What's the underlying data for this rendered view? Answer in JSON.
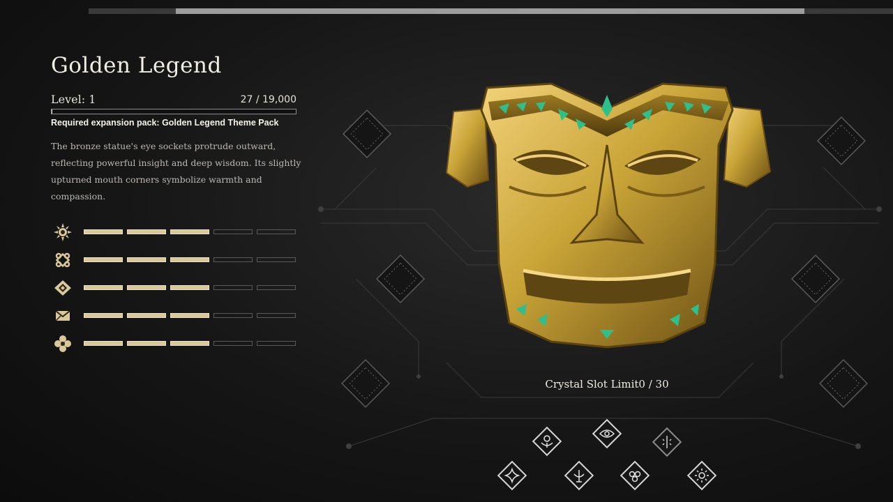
{
  "item": {
    "title": "Golden Legend",
    "level_text": "Level: 1",
    "xp_text": "27 / 19,000",
    "xp_progress": 0.0014,
    "required_pack": "Required expansion pack: Golden Legend Theme Pack",
    "description": "The bronze statue's eye sockets protrude outward, reflecting powerful insight and deep wisdom. Its slightly upturned mouth corners symbolize warmth and compassion."
  },
  "stats": [
    {
      "icon": "sun-emblem-icon",
      "filled": 3,
      "total": 5
    },
    {
      "icon": "knot-emblem-icon",
      "filled": 3,
      "total": 5
    },
    {
      "icon": "diamond-emblem-icon",
      "filled": 3,
      "total": 5
    },
    {
      "icon": "envelope-emblem-icon",
      "filled": 3,
      "total": 5
    },
    {
      "icon": "flower-emblem-icon",
      "filled": 3,
      "total": 5
    }
  ],
  "crystal_slot_label": "Crystal Slot Limit0 / 30",
  "crystals": [
    "flower-crystal-icon",
    "eye-crystal-icon",
    "rune-crystal-icon",
    "star-crystal-icon",
    "trident-crystal-icon",
    "spiral-crystal-icon",
    "sun-crystal-icon"
  ],
  "top_progress": 0.89,
  "colors": {
    "gold": "#c9a437",
    "jade": "#2fbf8a",
    "bar_on": "#d8c89a"
  }
}
